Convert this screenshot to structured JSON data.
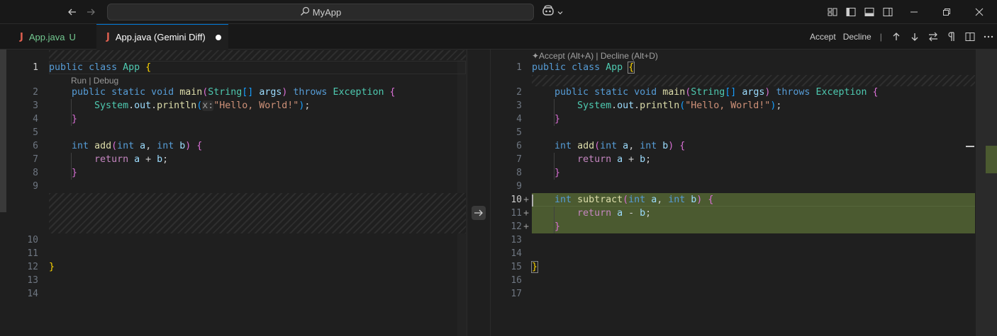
{
  "titlebar": {
    "search_text": "MyApp"
  },
  "tabs": [
    {
      "icon": "J",
      "label": "App.java",
      "status": "U"
    },
    {
      "icon": "J",
      "label": "App.java (Gemini Diff)"
    }
  ],
  "diff_toolbar": {
    "accept_label": "Accept",
    "decline_label": "Decline",
    "separator": "|"
  },
  "left_editor": {
    "codelens": "Run | Debug",
    "line_numbers": [
      "1",
      "2",
      "3",
      "4",
      "5",
      "6",
      "7",
      "8",
      "9",
      "10",
      "11",
      "12",
      "13",
      "14"
    ]
  },
  "right_editor": {
    "inline_actions": "✦Accept (Alt+A) | Decline (Alt+D)",
    "line_numbers": [
      "1",
      "2",
      "3",
      "4",
      "5",
      "6",
      "7",
      "8",
      "9",
      "10",
      "11",
      "12",
      "13",
      "14",
      "15",
      "16",
      "17"
    ],
    "added_marker": "+"
  },
  "colors": {
    "accent": "#0078d4",
    "added_background": "#4b5a30",
    "untracked": "#73c991",
    "java_icon": "#e06050"
  }
}
